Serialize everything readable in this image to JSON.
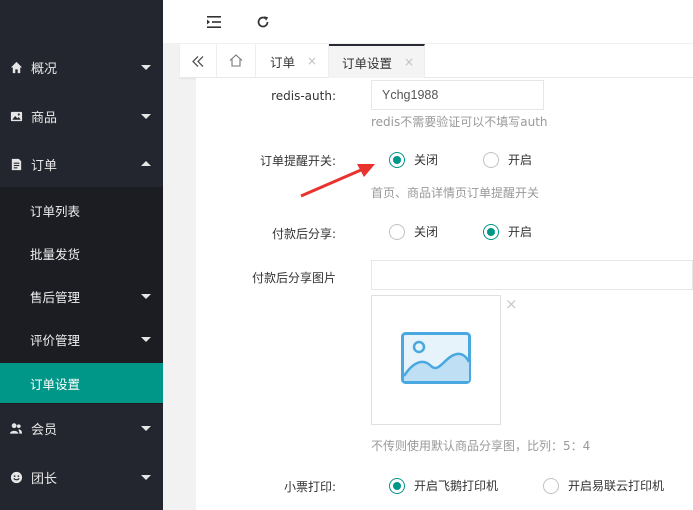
{
  "sidebar": {
    "items": [
      {
        "label": "概况",
        "icon": "home-icon"
      },
      {
        "label": "商品",
        "icon": "image-icon"
      },
      {
        "label": "订单",
        "icon": "document-icon"
      },
      {
        "label": "会员",
        "icon": "users-icon"
      },
      {
        "label": "团长",
        "icon": "smile-icon"
      }
    ],
    "sub_items": [
      {
        "label": "订单列表"
      },
      {
        "label": "批量发货"
      },
      {
        "label": "售后管理"
      },
      {
        "label": "评价管理"
      },
      {
        "label": "订单设置"
      }
    ]
  },
  "header": {
    "menu_icon": "menu-collapse-icon",
    "refresh_icon": "refresh-icon"
  },
  "tabs": {
    "back_icon": "double-chevron-left-icon",
    "home_icon": "home-outline-icon",
    "items": [
      {
        "label": "订单",
        "close": "×"
      },
      {
        "label": "订单设置",
        "close": "×"
      }
    ]
  },
  "form": {
    "redis_auth": {
      "label": "redis-auth:",
      "value": "Ychg1988",
      "hint": "redis不需要验证可以不填写auth"
    },
    "order_reminder": {
      "label": "订单提醒开关:",
      "options": [
        "关闭",
        "开启"
      ],
      "selected": "关闭",
      "hint": "首页、商品详情页订单提醒开关"
    },
    "share_after_pay": {
      "label": "付款后分享:",
      "options": [
        "关闭",
        "开启"
      ],
      "selected": "开启"
    },
    "share_image": {
      "label": "付款后分享图片",
      "value": "",
      "remove": "×",
      "hint": "不传则使用默认商品分享图，比列：5：4"
    },
    "ticket_print": {
      "label": "小票打印:",
      "options": [
        "开启飞鹅打印机",
        "开启易联云打印机"
      ],
      "selected": "开启飞鹅打印机"
    }
  },
  "colors": {
    "sidebar_bg": "#23262e",
    "accent": "#009688",
    "annotation_arrow": "#e8322e"
  }
}
